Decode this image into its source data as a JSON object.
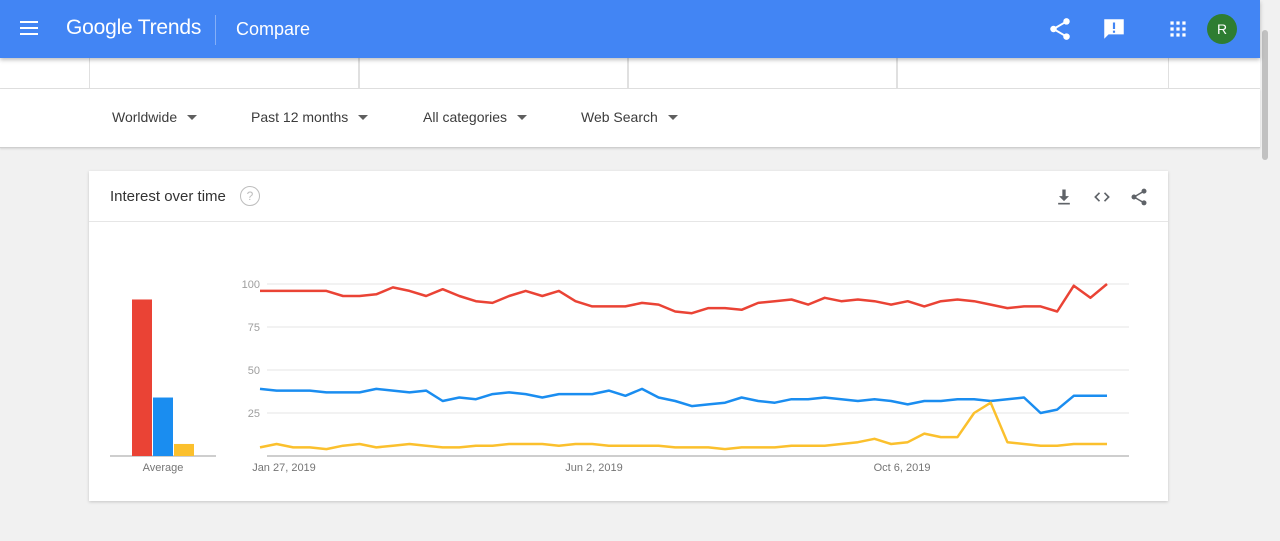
{
  "appbar": {
    "menu_icon": "menu-icon",
    "logo": "Google Trends",
    "page_title": "Compare",
    "icons": [
      "share-icon",
      "feedback-icon",
      "apps-grid-icon"
    ],
    "avatar_letter": "R",
    "bar_color": "#4285f4",
    "avatar_color": "#2e7d32"
  },
  "filters": {
    "region": "Worldwide",
    "time": "Past 12 months",
    "category": "All categories",
    "search_type": "Web Search"
  },
  "card": {
    "title": "Interest over time",
    "icons": [
      "help-icon",
      "download-icon",
      "embed-code-icon",
      "share-icon"
    ]
  },
  "chart_data": {
    "type": "line",
    "y_ticks": [
      "100",
      "75",
      "50",
      "25"
    ],
    "x_labels": [
      "Jan 27, 2019",
      "Jun 2, 2019",
      "Oct 6, 2019"
    ],
    "ylim": [
      0,
      100
    ],
    "grid": true,
    "average_label": "Average",
    "series": [
      {
        "color": "#ea4335",
        "average": 91,
        "values": [
          96,
          96,
          96,
          96,
          96,
          93,
          93,
          94,
          98,
          96,
          93,
          97,
          93,
          90,
          89,
          93,
          96,
          93,
          96,
          90,
          87,
          87,
          87,
          89,
          88,
          84,
          83,
          86,
          86,
          85,
          89,
          90,
          91,
          88,
          92,
          90,
          91,
          90,
          88,
          90,
          87,
          90,
          91,
          90,
          88,
          86,
          87,
          87,
          84,
          99,
          92,
          100
        ]
      },
      {
        "color": "#1a8df0",
        "average": 34,
        "values": [
          39,
          38,
          38,
          38,
          37,
          37,
          37,
          39,
          38,
          37,
          38,
          32,
          34,
          33,
          36,
          37,
          36,
          34,
          36,
          36,
          36,
          38,
          35,
          39,
          34,
          32,
          29,
          30,
          31,
          34,
          32,
          31,
          33,
          33,
          34,
          33,
          32,
          33,
          32,
          30,
          32,
          32,
          33,
          33,
          32,
          33,
          34,
          25,
          27,
          35,
          35,
          35
        ]
      },
      {
        "color": "#fbc02d",
        "average": 7,
        "values": [
          5,
          7,
          5,
          5,
          4,
          6,
          7,
          5,
          6,
          7,
          6,
          5,
          5,
          6,
          6,
          7,
          7,
          7,
          6,
          7,
          7,
          6,
          6,
          6,
          6,
          5,
          5,
          5,
          4,
          5,
          5,
          5,
          6,
          6,
          6,
          7,
          8,
          10,
          7,
          8,
          13,
          11,
          11,
          25,
          31,
          8,
          7,
          6,
          6,
          7,
          7,
          7
        ]
      }
    ]
  }
}
